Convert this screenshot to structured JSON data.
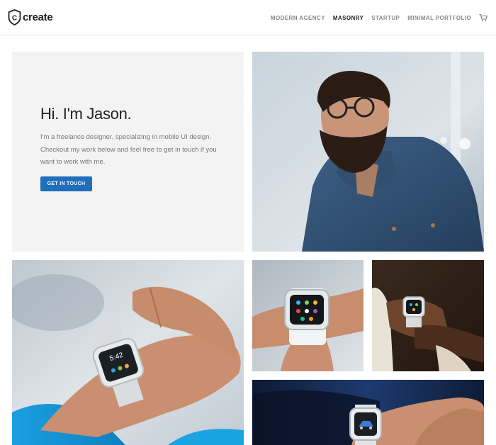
{
  "brand": {
    "logo_letter": "C",
    "name": "create"
  },
  "nav": {
    "items": [
      {
        "label": "MODERN AGENCY",
        "active": false
      },
      {
        "label": "MASONRY",
        "active": true
      },
      {
        "label": "STARTUP",
        "active": false
      },
      {
        "label": "MINIMAL PORTFOLIO",
        "active": false
      }
    ],
    "cart_icon": "shopping-cart-icon"
  },
  "intro": {
    "heading": "Hi. I'm Jason.",
    "body": "I'm a freelance designer, specializing in mobile UI design. Checkout my work below and feel free to get in touch if you want to work with me.",
    "button_label": "GET IN TOUCH"
  },
  "tiles": [
    {
      "name": "portrait-photo",
      "subject": "bearded man with glasses in denim shirt"
    },
    {
      "name": "smartwatch-large-photo",
      "subject": "hands using smartwatch, blue sleeve"
    },
    {
      "name": "smartwatch-white-photo",
      "subject": "white smartwatch on wrist"
    },
    {
      "name": "smartwatch-dark-photo",
      "subject": "smartwatch on wrist, dark wood background"
    },
    {
      "name": "smartwatch-car-photo",
      "subject": "smartwatch on wrist in car"
    }
  ],
  "watch": {
    "time": "5:42"
  },
  "colors": {
    "accent": "#1f6fbd",
    "intro_bg": "#f3f3f3"
  }
}
